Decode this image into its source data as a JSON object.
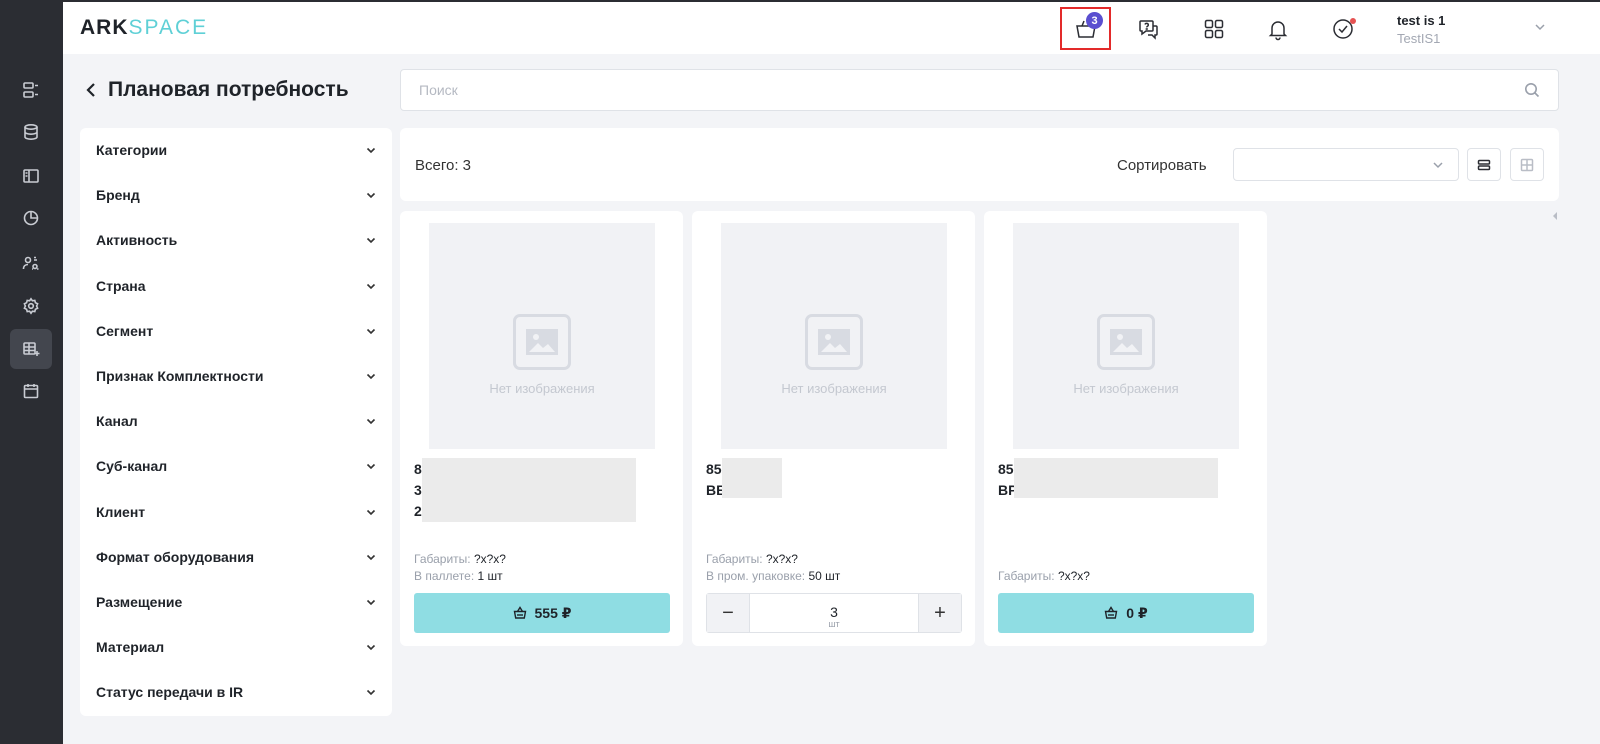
{
  "app": {
    "logo_main": "ARK",
    "logo_accent": "SPACE"
  },
  "header": {
    "cart_count": "3",
    "user_name": "test is 1",
    "user_org": "TestIS1"
  },
  "page": {
    "title": "Плановая потребность"
  },
  "search": {
    "placeholder": "Поиск",
    "value": ""
  },
  "rail": {
    "items": [
      {
        "icon": "list-details-icon",
        "active": false
      },
      {
        "icon": "database-icon",
        "active": false
      },
      {
        "icon": "layout-sidebar-icon",
        "active": false
      },
      {
        "icon": "pie-chart-icon",
        "active": false
      },
      {
        "icon": "users-settings-icon",
        "active": false
      },
      {
        "icon": "gear-icon",
        "active": false
      },
      {
        "icon": "table-add-icon",
        "active": true
      },
      {
        "icon": "calendar-icon",
        "active": false
      }
    ]
  },
  "filters": [
    "Категории",
    "Бренд",
    "Активность",
    "Страна",
    "Сегмент",
    "Признак Комплектности",
    "Канал",
    "Суб-канал",
    "Клиент",
    "Формат оборудования",
    "Размещение",
    "Материал",
    "Статус передачи в IR"
  ],
  "toolbar": {
    "total": "Всего: 3",
    "sort_label": "Сортировать",
    "sort_value": ""
  },
  "cards": [
    {
      "no_image": "Нет изображения",
      "title": "855\n3-п                                   IY\n202",
      "spec_1_label": "Габариты: ",
      "spec_1_value": "?x?x?",
      "spec_2_label": "В паллете: ",
      "spec_2_value": "1 шт",
      "price": "555 ₽"
    },
    {
      "no_image": "Нет изображения",
      "title": "855\nBB             ik",
      "spec_1_label": "Габариты: ",
      "spec_1_value": "?x?x?",
      "spec_2_label": "В пром. упаковке: ",
      "spec_2_value": "50 шт",
      "qty": "3",
      "qty_unit": "шт"
    },
    {
      "no_image": "Нет изображения",
      "title": "855\nBP                                        бо",
      "spec_1_label": "Габариты: ",
      "spec_1_value": "?x?x?",
      "price": "0 ₽"
    }
  ],
  "colors": {
    "accent": "#8fdde3",
    "badge": "#5a4fd0",
    "highlight": "#e32a2a",
    "rail": "#2b2d33"
  }
}
